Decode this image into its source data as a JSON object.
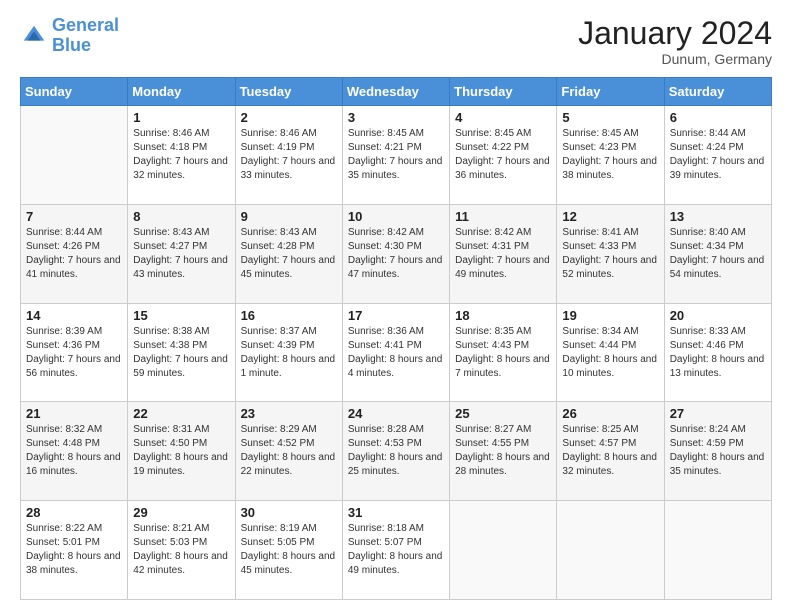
{
  "logo": {
    "line1": "General",
    "line2": "Blue"
  },
  "header": {
    "month": "January 2024",
    "location": "Dunum, Germany"
  },
  "weekdays": [
    "Sunday",
    "Monday",
    "Tuesday",
    "Wednesday",
    "Thursday",
    "Friday",
    "Saturday"
  ],
  "weeks": [
    [
      {
        "day": "",
        "sunrise": "",
        "sunset": "",
        "daylight": ""
      },
      {
        "day": "1",
        "sunrise": "Sunrise: 8:46 AM",
        "sunset": "Sunset: 4:18 PM",
        "daylight": "Daylight: 7 hours and 32 minutes."
      },
      {
        "day": "2",
        "sunrise": "Sunrise: 8:46 AM",
        "sunset": "Sunset: 4:19 PM",
        "daylight": "Daylight: 7 hours and 33 minutes."
      },
      {
        "day": "3",
        "sunrise": "Sunrise: 8:45 AM",
        "sunset": "Sunset: 4:21 PM",
        "daylight": "Daylight: 7 hours and 35 minutes."
      },
      {
        "day": "4",
        "sunrise": "Sunrise: 8:45 AM",
        "sunset": "Sunset: 4:22 PM",
        "daylight": "Daylight: 7 hours and 36 minutes."
      },
      {
        "day": "5",
        "sunrise": "Sunrise: 8:45 AM",
        "sunset": "Sunset: 4:23 PM",
        "daylight": "Daylight: 7 hours and 38 minutes."
      },
      {
        "day": "6",
        "sunrise": "Sunrise: 8:44 AM",
        "sunset": "Sunset: 4:24 PM",
        "daylight": "Daylight: 7 hours and 39 minutes."
      }
    ],
    [
      {
        "day": "7",
        "sunrise": "Sunrise: 8:44 AM",
        "sunset": "Sunset: 4:26 PM",
        "daylight": "Daylight: 7 hours and 41 minutes."
      },
      {
        "day": "8",
        "sunrise": "Sunrise: 8:43 AM",
        "sunset": "Sunset: 4:27 PM",
        "daylight": "Daylight: 7 hours and 43 minutes."
      },
      {
        "day": "9",
        "sunrise": "Sunrise: 8:43 AM",
        "sunset": "Sunset: 4:28 PM",
        "daylight": "Daylight: 7 hours and 45 minutes."
      },
      {
        "day": "10",
        "sunrise": "Sunrise: 8:42 AM",
        "sunset": "Sunset: 4:30 PM",
        "daylight": "Daylight: 7 hours and 47 minutes."
      },
      {
        "day": "11",
        "sunrise": "Sunrise: 8:42 AM",
        "sunset": "Sunset: 4:31 PM",
        "daylight": "Daylight: 7 hours and 49 minutes."
      },
      {
        "day": "12",
        "sunrise": "Sunrise: 8:41 AM",
        "sunset": "Sunset: 4:33 PM",
        "daylight": "Daylight: 7 hours and 52 minutes."
      },
      {
        "day": "13",
        "sunrise": "Sunrise: 8:40 AM",
        "sunset": "Sunset: 4:34 PM",
        "daylight": "Daylight: 7 hours and 54 minutes."
      }
    ],
    [
      {
        "day": "14",
        "sunrise": "Sunrise: 8:39 AM",
        "sunset": "Sunset: 4:36 PM",
        "daylight": "Daylight: 7 hours and 56 minutes."
      },
      {
        "day": "15",
        "sunrise": "Sunrise: 8:38 AM",
        "sunset": "Sunset: 4:38 PM",
        "daylight": "Daylight: 7 hours and 59 minutes."
      },
      {
        "day": "16",
        "sunrise": "Sunrise: 8:37 AM",
        "sunset": "Sunset: 4:39 PM",
        "daylight": "Daylight: 8 hours and 1 minute."
      },
      {
        "day": "17",
        "sunrise": "Sunrise: 8:36 AM",
        "sunset": "Sunset: 4:41 PM",
        "daylight": "Daylight: 8 hours and 4 minutes."
      },
      {
        "day": "18",
        "sunrise": "Sunrise: 8:35 AM",
        "sunset": "Sunset: 4:43 PM",
        "daylight": "Daylight: 8 hours and 7 minutes."
      },
      {
        "day": "19",
        "sunrise": "Sunrise: 8:34 AM",
        "sunset": "Sunset: 4:44 PM",
        "daylight": "Daylight: 8 hours and 10 minutes."
      },
      {
        "day": "20",
        "sunrise": "Sunrise: 8:33 AM",
        "sunset": "Sunset: 4:46 PM",
        "daylight": "Daylight: 8 hours and 13 minutes."
      }
    ],
    [
      {
        "day": "21",
        "sunrise": "Sunrise: 8:32 AM",
        "sunset": "Sunset: 4:48 PM",
        "daylight": "Daylight: 8 hours and 16 minutes."
      },
      {
        "day": "22",
        "sunrise": "Sunrise: 8:31 AM",
        "sunset": "Sunset: 4:50 PM",
        "daylight": "Daylight: 8 hours and 19 minutes."
      },
      {
        "day": "23",
        "sunrise": "Sunrise: 8:29 AM",
        "sunset": "Sunset: 4:52 PM",
        "daylight": "Daylight: 8 hours and 22 minutes."
      },
      {
        "day": "24",
        "sunrise": "Sunrise: 8:28 AM",
        "sunset": "Sunset: 4:53 PM",
        "daylight": "Daylight: 8 hours and 25 minutes."
      },
      {
        "day": "25",
        "sunrise": "Sunrise: 8:27 AM",
        "sunset": "Sunset: 4:55 PM",
        "daylight": "Daylight: 8 hours and 28 minutes."
      },
      {
        "day": "26",
        "sunrise": "Sunrise: 8:25 AM",
        "sunset": "Sunset: 4:57 PM",
        "daylight": "Daylight: 8 hours and 32 minutes."
      },
      {
        "day": "27",
        "sunrise": "Sunrise: 8:24 AM",
        "sunset": "Sunset: 4:59 PM",
        "daylight": "Daylight: 8 hours and 35 minutes."
      }
    ],
    [
      {
        "day": "28",
        "sunrise": "Sunrise: 8:22 AM",
        "sunset": "Sunset: 5:01 PM",
        "daylight": "Daylight: 8 hours and 38 minutes."
      },
      {
        "day": "29",
        "sunrise": "Sunrise: 8:21 AM",
        "sunset": "Sunset: 5:03 PM",
        "daylight": "Daylight: 8 hours and 42 minutes."
      },
      {
        "day": "30",
        "sunrise": "Sunrise: 8:19 AM",
        "sunset": "Sunset: 5:05 PM",
        "daylight": "Daylight: 8 hours and 45 minutes."
      },
      {
        "day": "31",
        "sunrise": "Sunrise: 8:18 AM",
        "sunset": "Sunset: 5:07 PM",
        "daylight": "Daylight: 8 hours and 49 minutes."
      },
      {
        "day": "",
        "sunrise": "",
        "sunset": "",
        "daylight": ""
      },
      {
        "day": "",
        "sunrise": "",
        "sunset": "",
        "daylight": ""
      },
      {
        "day": "",
        "sunrise": "",
        "sunset": "",
        "daylight": ""
      }
    ]
  ]
}
